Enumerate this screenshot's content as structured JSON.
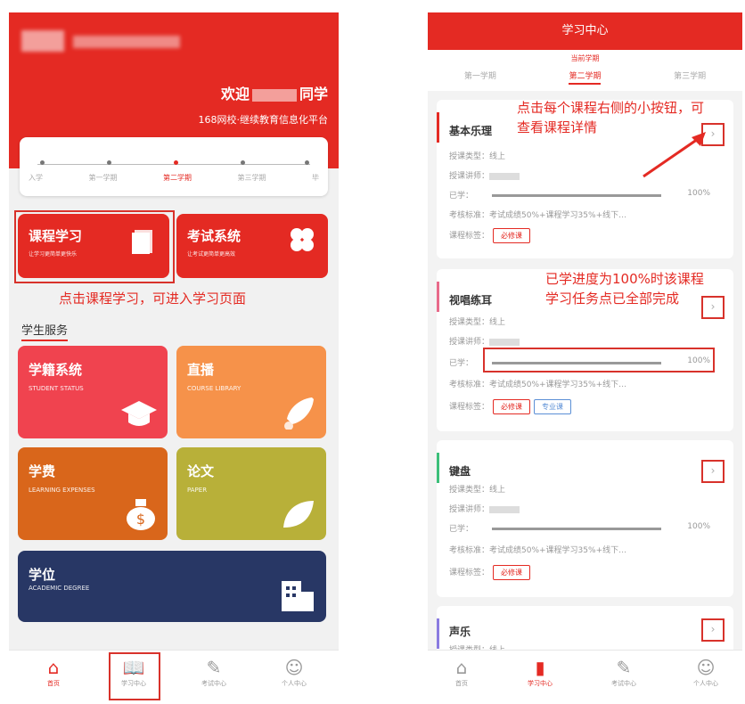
{
  "left": {
    "header": {
      "welcome_prefix": "欢迎",
      "welcome_suffix": "同学",
      "platform": "168网校·继续教育信息化平台"
    },
    "semesters": [
      "入学",
      "第一学期",
      "第二学期",
      "第三学期",
      "毕"
    ],
    "active_semester_index": 2,
    "tiles": [
      {
        "title": "课程学习",
        "subtitle": "让学习更简单更快乐",
        "color": "#e42a23"
      },
      {
        "title": "考试系统",
        "subtitle": "让考试更简单更高效",
        "color": "#e42a23"
      }
    ],
    "annotation": "点击课程学习，可进入学习页面",
    "section_title": "学生服务",
    "services": [
      {
        "title": "学籍系统",
        "subtitle": "STUDENT STATUS",
        "color": "#f0434f",
        "icon": "graduation-cap-icon"
      },
      {
        "title": "直播",
        "subtitle": "COURSE LIBRARY",
        "color": "#f6924a",
        "icon": "rocket-icon"
      },
      {
        "title": "学费",
        "subtitle": "LEARNING EXPENSES",
        "color": "#d9661b",
        "icon": "money-bag-icon"
      },
      {
        "title": "论文",
        "subtitle": "PAPER",
        "color": "#b8b039",
        "icon": "leaf-icon"
      },
      {
        "title": "学位",
        "subtitle": "ACADEMIC DEGREE",
        "color": "#283765",
        "icon": "building-icon"
      }
    ],
    "tabbar": [
      {
        "label": "首页",
        "icon": "home-icon",
        "active": true
      },
      {
        "label": "学习中心",
        "icon": "book-icon",
        "active": false
      },
      {
        "label": "考试中心",
        "icon": "pen-icon",
        "active": false
      },
      {
        "label": "个人中心",
        "icon": "user-icon",
        "active": false
      }
    ]
  },
  "right": {
    "title": "学习中心",
    "current_semester": "当前学期",
    "tabs": [
      "第一学期",
      "第二学期",
      "第三学期"
    ],
    "active_tab_index": 1,
    "annotation_1": "点击每个课程右侧的小按钮，可查看课程详情",
    "annotation_2": "已学进度为100%时该课程学习任务点已全部完成",
    "labels": {
      "type": "授课类型：",
      "teacher": "授课讲师：",
      "learned": "已学：",
      "standard": "考核标准：",
      "course_tag": "课程标签："
    },
    "courses": [
      {
        "name": "基本乐理",
        "type": "线上",
        "progress": "100%",
        "standard": "考试成绩50%+课程学习35%+线下…",
        "tags": [
          "必修课"
        ],
        "color": "#e42a23"
      },
      {
        "name": "视唱练耳",
        "type": "线上",
        "progress": "100%",
        "standard": "考试成绩50%+课程学习35%+线下…",
        "tags": [
          "必修课",
          "专业课"
        ],
        "color": "#e86a8a"
      },
      {
        "name": "键盘",
        "type": "线上",
        "progress": "100%",
        "standard": "考试成绩50%+课程学习35%+线下…",
        "tags": [
          "必修课"
        ],
        "color": "#3cbf7a"
      },
      {
        "name": "声乐",
        "type": "线上",
        "progress": "",
        "standard": "",
        "tags": [],
        "color": "#8a7be0"
      }
    ],
    "tabbar": [
      {
        "label": "首页",
        "icon": "home-icon",
        "active": false
      },
      {
        "label": "学习中心",
        "icon": "book-icon",
        "active": true
      },
      {
        "label": "考试中心",
        "icon": "pen-icon",
        "active": false
      },
      {
        "label": "个人中心",
        "icon": "user-icon",
        "active": false
      }
    ]
  }
}
